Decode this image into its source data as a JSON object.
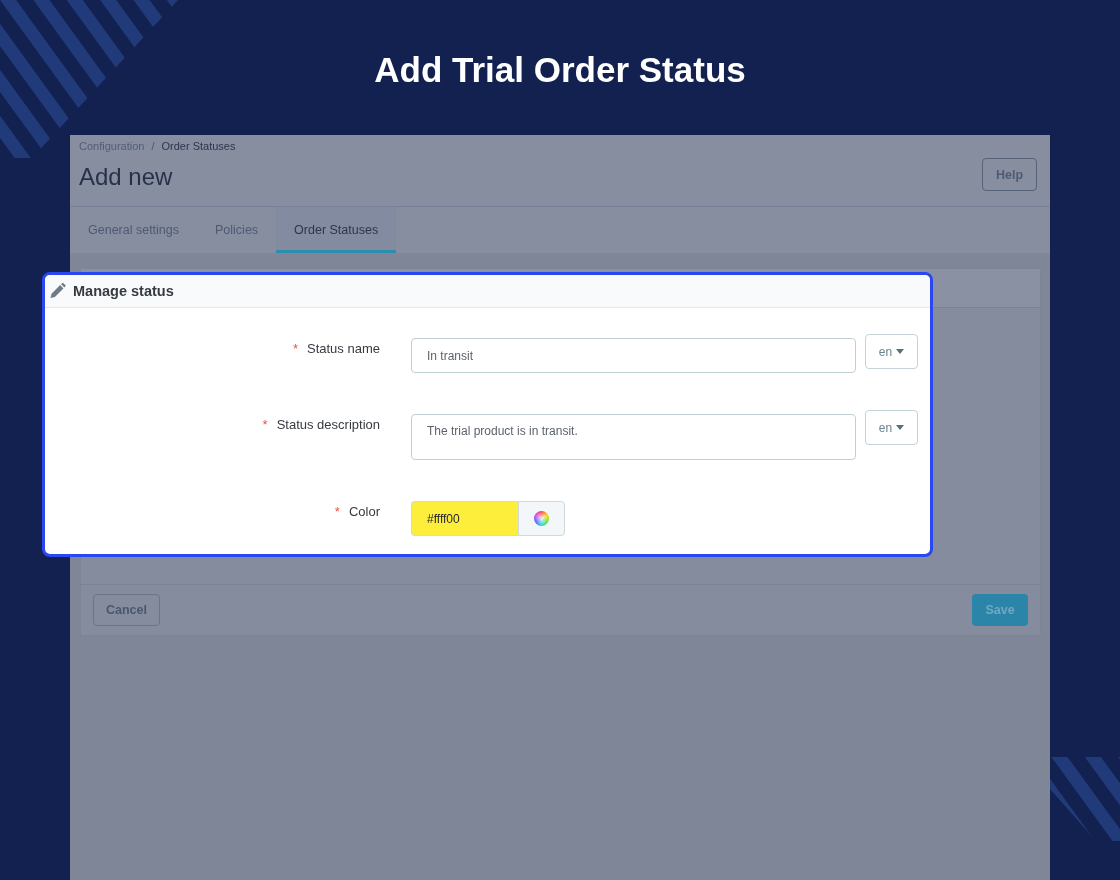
{
  "heading": "Add Trial Order Status",
  "admin": {
    "breadcrumb": [
      {
        "label": "Configuration",
        "current": false
      },
      {
        "label": "Order Statuses",
        "current": true
      }
    ],
    "breadcrumb_separator": "/",
    "page_title": "Add new",
    "help_button": "Help",
    "tabs": [
      {
        "label": "General settings",
        "selected": false
      },
      {
        "label": "Policies",
        "selected": false
      },
      {
        "label": "Order Statuses",
        "selected": true
      }
    ],
    "form": {
      "title": "Manage status",
      "fields": [
        {
          "kind": "text",
          "required_mark": "*",
          "label": "Status name",
          "value": "In transit",
          "language": "en"
        },
        {
          "kind": "textarea",
          "required_mark": "*",
          "label": "Status description",
          "value": "The trial product is in transit.",
          "language": "en"
        },
        {
          "kind": "color",
          "required_mark": "*",
          "label": "Color",
          "value": "#ffff00",
          "color": "#fcee3a"
        }
      ]
    },
    "cancel_button": "Cancel",
    "save_button": "Save"
  }
}
